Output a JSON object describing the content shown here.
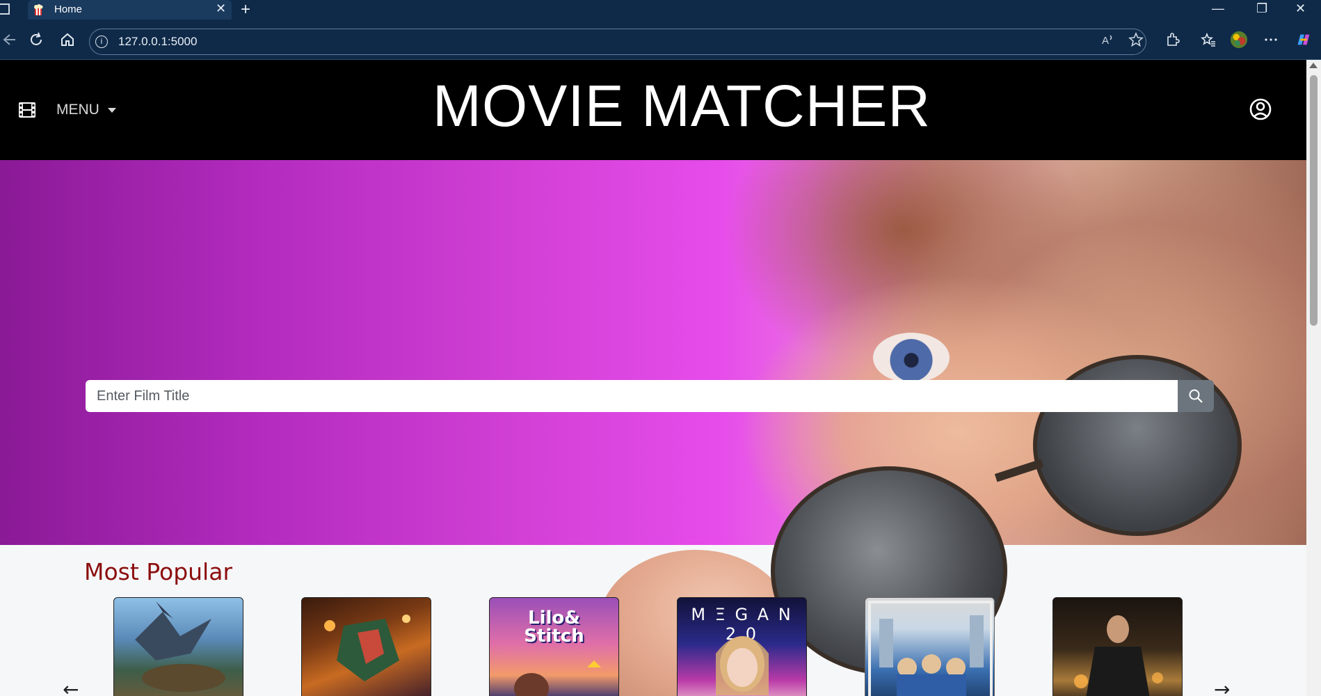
{
  "browser": {
    "tab_title": "Home",
    "url": "127.0.0.1:5000",
    "new_tab_symbol": "+",
    "close_tab_symbol": "✕",
    "minimize_symbol": "—",
    "restore_symbol": "❐",
    "close_window_symbol": "✕"
  },
  "header": {
    "menu_label": "MENU",
    "site_title": "MOVIE MATCHER"
  },
  "search": {
    "placeholder": "Enter Film Title",
    "value": ""
  },
  "most_popular": {
    "title": "Most Popular",
    "prev_arrow": "←",
    "next_arrow": "→",
    "posters": [
      {
        "title": "",
        "art_text": ""
      },
      {
        "title": "",
        "art_text": ""
      },
      {
        "title": "Lilo & Stitch",
        "art_text": "Lilo&\nStitch"
      },
      {
        "title": "M3GAN 2.0",
        "art_text": "M Ξ G A N 2.0"
      },
      {
        "title": "",
        "art_text": ""
      },
      {
        "title": "",
        "art_text": ""
      }
    ]
  },
  "colors": {
    "header_bg": "#000000",
    "section_title": "#8b0d0d",
    "search_button": "#6c757d",
    "browser_chrome": "#0f2a48"
  }
}
